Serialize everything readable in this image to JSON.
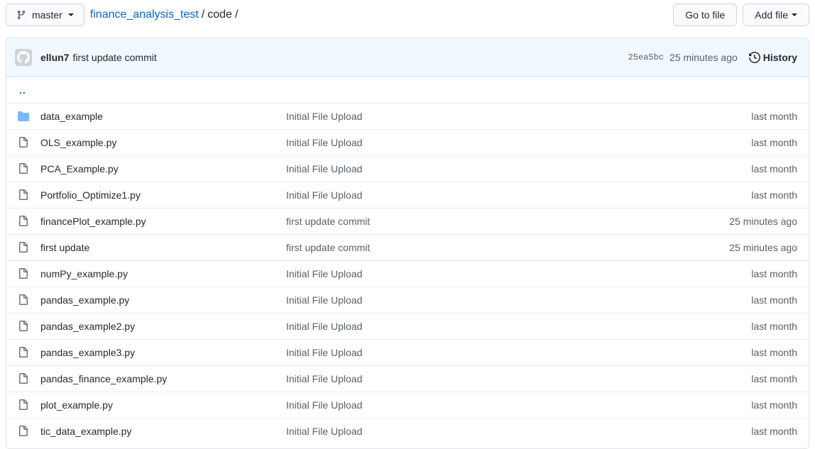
{
  "header": {
    "branch": "master",
    "repo": "finance_analysis_test",
    "separator": "/",
    "path": "code",
    "trailing_separator": "/",
    "go_to_file_label": "Go to file",
    "add_file_label": "Add file"
  },
  "commit": {
    "author": "ellun7",
    "message": "first update commit",
    "sha": "25ea5bc",
    "time": "25 minutes ago",
    "history_label": "History"
  },
  "parent_dir": "..",
  "files": [
    {
      "type": "folder",
      "name": "data_example",
      "message": "Initial File Upload",
      "age": "last month"
    },
    {
      "type": "file",
      "name": "OLS_example.py",
      "message": "Initial File Upload",
      "age": "last month"
    },
    {
      "type": "file",
      "name": "PCA_Example.py",
      "message": "Initial File Upload",
      "age": "last month"
    },
    {
      "type": "file",
      "name": "Portfolio_Optimize1.py",
      "message": "Initial File Upload",
      "age": "last month"
    },
    {
      "type": "file",
      "name": "financePlot_example.py",
      "message": "first update commit",
      "age": "25 minutes ago"
    },
    {
      "type": "file",
      "name": "first update",
      "message": "first update commit",
      "age": "25 minutes ago"
    },
    {
      "type": "file",
      "name": "numPy_example.py",
      "message": "Initial File Upload",
      "age": "last month"
    },
    {
      "type": "file",
      "name": "pandas_example.py",
      "message": "Initial File Upload",
      "age": "last month"
    },
    {
      "type": "file",
      "name": "pandas_example2.py",
      "message": "Initial File Upload",
      "age": "last month"
    },
    {
      "type": "file",
      "name": "pandas_example3.py",
      "message": "Initial File Upload",
      "age": "last month"
    },
    {
      "type": "file",
      "name": "pandas_finance_example.py",
      "message": "Initial File Upload",
      "age": "last month"
    },
    {
      "type": "file",
      "name": "plot_example.py",
      "message": "Initial File Upload",
      "age": "last month"
    },
    {
      "type": "file",
      "name": "tic_data_example.py",
      "message": "Initial File Upload",
      "age": "last month"
    }
  ],
  "colors": {
    "link": "#0366d6",
    "folder": "#79b8ff",
    "commit_bar_bg": "#f1f8ff"
  }
}
